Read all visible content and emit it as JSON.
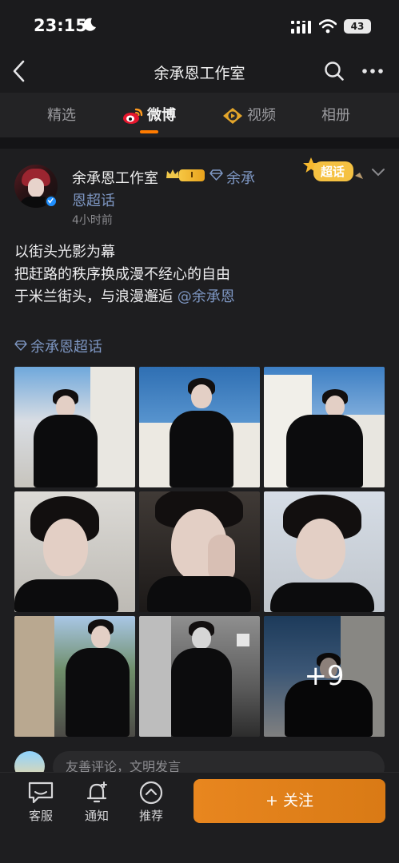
{
  "status_bar": {
    "time": "23:15",
    "battery": "43",
    "icons": [
      "moon-icon",
      "signal-icon",
      "wifi-icon",
      "battery-icon"
    ]
  },
  "nav": {
    "title": "余承恩工作室",
    "icons": [
      "back-icon",
      "search-icon",
      "more-icon"
    ]
  },
  "tabs": [
    {
      "label": "精选",
      "active": false
    },
    {
      "label": "微博",
      "active": true,
      "icon": "weibo-icon"
    },
    {
      "label": "视频",
      "active": false,
      "icon": "video-icon"
    },
    {
      "label": "相册",
      "active": false
    }
  ],
  "post": {
    "author": "余承恩工作室",
    "level_badge": "I",
    "topic_inline_line1": "余承",
    "topic_inline_line2": "恩超话",
    "time": "4小时前",
    "supertopic_badge": "超话",
    "text_lines": [
      "以街头光影为幕",
      "把赶路的秩序换成漫不经心的自由",
      "于米兰街头，与浪漫邂逅"
    ],
    "mention": "@余承恩",
    "topic": "余承恩超话",
    "photos_more": "+9"
  },
  "comment": {
    "placeholder": "友善评论，文明发言"
  },
  "bottom_bar": {
    "items": [
      {
        "label": "客服",
        "icon": "customer-service-icon"
      },
      {
        "label": "通知",
        "icon": "bell-icon"
      },
      {
        "label": "推荐",
        "icon": "recommend-icon"
      }
    ],
    "follow_label": "+ 关注"
  },
  "colors": {
    "accent": "#ff7b00",
    "link": "#7e97c3",
    "follow": "#e8861f",
    "background": "#1b1b1d"
  }
}
